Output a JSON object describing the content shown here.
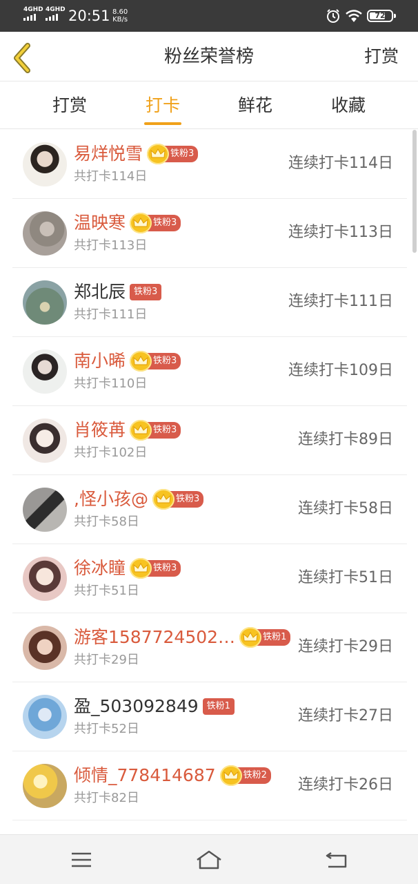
{
  "status_bar": {
    "network_1": "4GHD",
    "network_2": "4GHD",
    "time": "20:51",
    "speed_value": "8.60",
    "speed_unit": "KB/s",
    "battery": "72",
    "battery_level": 0.72
  },
  "header": {
    "title": "粉丝荣誉榜",
    "right_action": "打赏"
  },
  "tabs": [
    {
      "label": "打赏",
      "active": false
    },
    {
      "label": "打卡",
      "active": true
    },
    {
      "label": "鲜花",
      "active": false
    },
    {
      "label": "收藏",
      "active": false
    }
  ],
  "accent_color": "#f0a11a",
  "name_color": "#d95a3c",
  "badge_color": "#d85b4b",
  "fans": [
    {
      "name": "易烊悦雪",
      "highlight": true,
      "crown": true,
      "badge": "铁粉3",
      "total": "共打卡114日",
      "streak": "连续打卡114日"
    },
    {
      "name": "温映寒",
      "highlight": true,
      "crown": true,
      "badge": "铁粉3",
      "total": "共打卡113日",
      "streak": "连续打卡113日"
    },
    {
      "name": "郑北辰",
      "highlight": false,
      "crown": false,
      "badge": "铁粉3",
      "total": "共打卡111日",
      "streak": "连续打卡111日"
    },
    {
      "name": "南小晞",
      "highlight": true,
      "crown": true,
      "badge": "铁粉3",
      "total": "共打卡110日",
      "streak": "连续打卡109日"
    },
    {
      "name": "肖筱苒",
      "highlight": true,
      "crown": true,
      "badge": "铁粉3",
      "total": "共打卡102日",
      "streak": "连续打卡89日"
    },
    {
      "name": ",怪小孩@",
      "highlight": true,
      "crown": true,
      "badge": "铁粉3",
      "total": "共打卡58日",
      "streak": "连续打卡58日"
    },
    {
      "name": "徐冰瞳",
      "highlight": true,
      "crown": true,
      "badge": "铁粉3",
      "total": "共打卡51日",
      "streak": "连续打卡51日"
    },
    {
      "name": "游客1587724502…",
      "highlight": true,
      "crown": true,
      "badge": "铁粉1",
      "total": "共打卡29日",
      "streak": "连续打卡29日"
    },
    {
      "name": "盈_503092849",
      "highlight": false,
      "crown": false,
      "badge": "铁粉1",
      "total": "共打卡52日",
      "streak": "连续打卡27日"
    },
    {
      "name": "倾情_778414687",
      "highlight": true,
      "crown": true,
      "badge": "铁粉2",
      "total": "共打卡82日",
      "streak": "连续打卡26日"
    }
  ]
}
